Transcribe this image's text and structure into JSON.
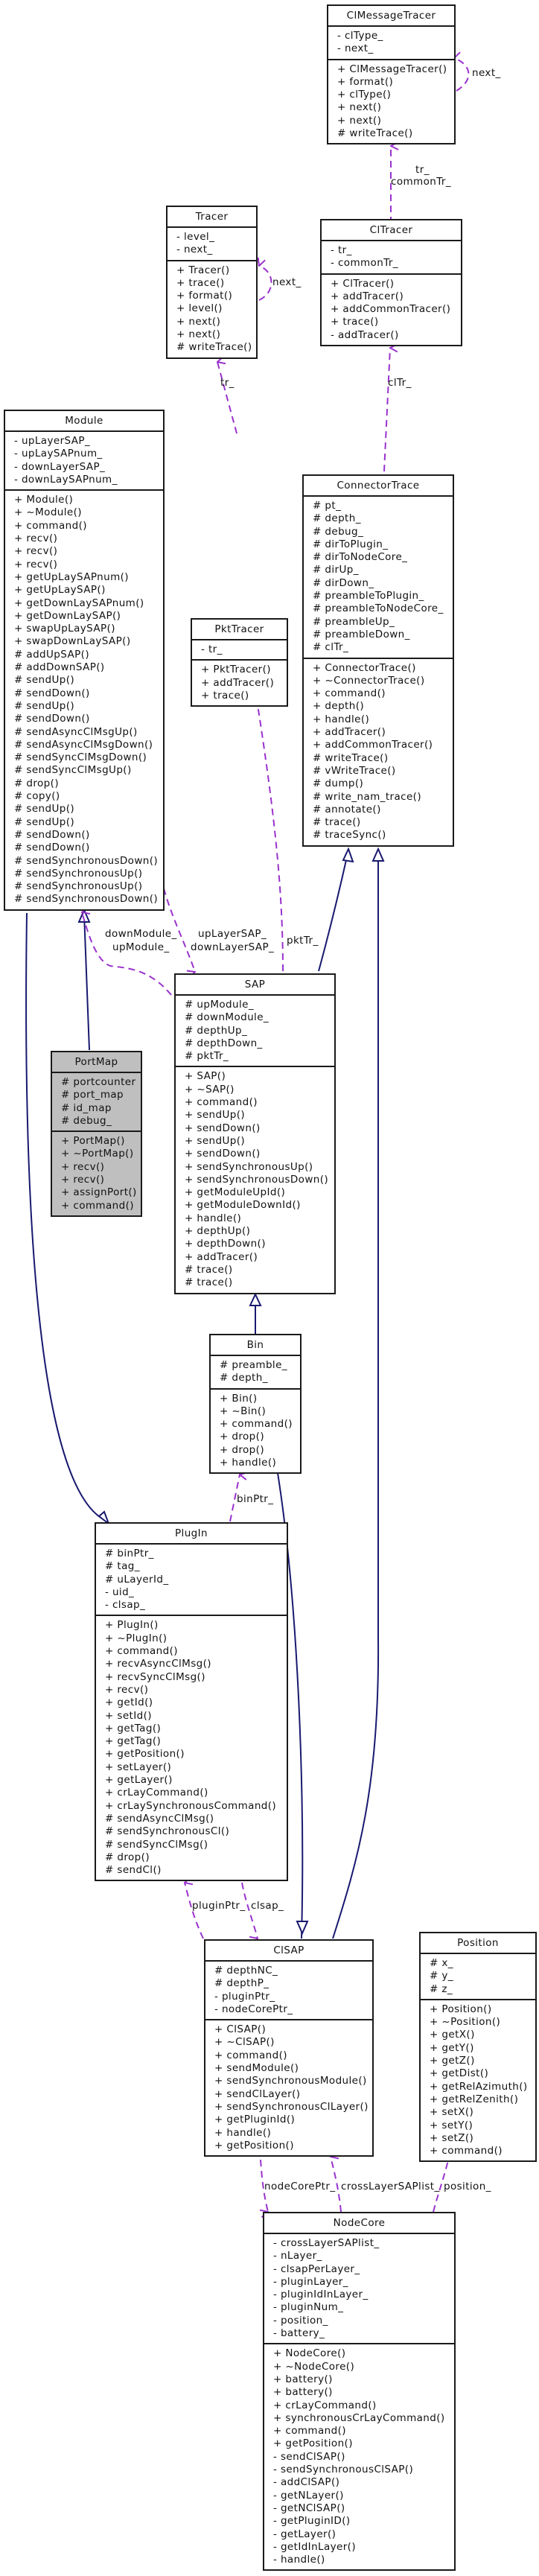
{
  "classes": {
    "clmessagetracer": {
      "name": "ClMessageTracer",
      "attributes": [
        "- clType_",
        "- next_"
      ],
      "methods": [
        "+ ClMessageTracer()",
        "+ format()",
        "+ clType()",
        "+ next()",
        "+ next()",
        "# writeTrace()"
      ]
    },
    "tracer": {
      "name": "Tracer",
      "attributes": [
        "- level_",
        "- next_"
      ],
      "methods": [
        "+ Tracer()",
        "+ trace()",
        "+ format()",
        "+ level()",
        "+ next()",
        "+ next()",
        "# writeTrace()"
      ]
    },
    "cltracer": {
      "name": "ClTracer",
      "attributes": [
        "- tr_",
        "- commonTr_"
      ],
      "methods": [
        "+ ClTracer()",
        "+ addTracer()",
        "+ addCommonTracer()",
        "+ trace()",
        "- addTracer()"
      ]
    },
    "module": {
      "name": "Module",
      "attributes": [
        "- upLayerSAP_",
        "- upLaySAPnum_",
        "- downLayerSAP_",
        "- downLaySAPnum_"
      ],
      "methods": [
        "+ Module()",
        "+ ~Module()",
        "+ command()",
        "+ recv()",
        "+ recv()",
        "+ recv()",
        "+ getUpLaySAPnum()",
        "+ getUpLaySAP()",
        "+ getDownLaySAPnum()",
        "+ getDownLaySAP()",
        "+ swapUpLaySAP()",
        "+ swapDownLaySAP()",
        "# addUpSAP()",
        "# addDownSAP()",
        "# sendUp()",
        "# sendDown()",
        "# sendUp()",
        "# sendDown()",
        "# sendAsyncClMsgUp()",
        "# sendAsyncClMsgDown()",
        "# sendSyncClMsgDown()",
        "# sendSyncClMsgUp()",
        "# drop()",
        "# copy()",
        "# sendUp()",
        "# sendUp()",
        "# sendDown()",
        "# sendDown()",
        "# sendSynchronousDown()",
        "# sendSynchronousUp()",
        "# sendSynchronousUp()",
        "# sendSynchronousDown()"
      ]
    },
    "pkttracer": {
      "name": "PktTracer",
      "attributes": [
        "- tr_"
      ],
      "methods": [
        "+ PktTracer()",
        "+ addTracer()",
        "+ trace()"
      ]
    },
    "connectortrace": {
      "name": "ConnectorTrace",
      "attributes": [
        "# pt_",
        "# depth_",
        "# debug_",
        "# dirToPlugin_",
        "# dirToNodeCore_",
        "# dirUp_",
        "# dirDown_",
        "# preambleToPlugin_",
        "# preambleToNodeCore_",
        "# preambleUp_",
        "# preambleDown_",
        "# clTr_"
      ],
      "methods": [
        "+ ConnectorTrace()",
        "+ ~ConnectorTrace()",
        "+ command()",
        "+ depth()",
        "+ handle()",
        "+ addTracer()",
        "+ addCommonTracer()",
        "# writeTrace()",
        "# vWriteTrace()",
        "# dump()",
        "# write_nam_trace()",
        "# annotate()",
        "# trace()",
        "# traceSync()"
      ]
    },
    "portmap": {
      "name": "PortMap",
      "attributes": [
        "# portcounter",
        "# port_map",
        "# id_map",
        "# debug_"
      ],
      "methods": [
        "+ PortMap()",
        "+ ~PortMap()",
        "+ recv()",
        "+ recv()",
        "+ assignPort()",
        "+ command()"
      ]
    },
    "sap": {
      "name": "SAP",
      "attributes": [
        "# upModule_",
        "# downModule_",
        "# depthUp_",
        "# depthDown_",
        "# pktTr_"
      ],
      "methods": [
        "+ SAP()",
        "+ ~SAP()",
        "+ command()",
        "+ sendUp()",
        "+ sendDown()",
        "+ sendUp()",
        "+ sendDown()",
        "+ sendSynchronousUp()",
        "+ sendSynchronousDown()",
        "+ getModuleUpId()",
        "+ getModuleDownId()",
        "+ handle()",
        "+ depthUp()",
        "+ depthDown()",
        "+ addTracer()",
        "# trace()",
        "# trace()"
      ]
    },
    "bin": {
      "name": "Bin",
      "attributes": [
        "# preamble_",
        "# depth_"
      ],
      "methods": [
        "+ Bin()",
        "+ ~Bin()",
        "+ command()",
        "+ drop()",
        "+ drop()",
        "+ handle()"
      ]
    },
    "plugin": {
      "name": "PlugIn",
      "attributes": [
        "# binPtr_",
        "# tag_",
        "# uLayerId_",
        "- uid_",
        "- clsap_"
      ],
      "methods": [
        "+ PlugIn()",
        "+ ~PlugIn()",
        "+ command()",
        "+ recvAsyncClMsg()",
        "+ recvSyncClMsg()",
        "+ recv()",
        "+ getId()",
        "+ setId()",
        "+ getTag()",
        "+ getTag()",
        "+ getPosition()",
        "+ setLayer()",
        "+ getLayer()",
        "+ crLayCommand()",
        "+ crLaySynchronousCommand()",
        "# sendAsyncClMsg()",
        "# sendSynchronousCl()",
        "# sendSyncClMsg()",
        "# drop()",
        "# sendCl()"
      ]
    },
    "clsap": {
      "name": "ClSAP",
      "attributes": [
        "# depthNC_",
        "# depthP_",
        "- pluginPtr_",
        "- nodeCorePtr_"
      ],
      "methods": [
        "+ ClSAP()",
        "+ ~ClSAP()",
        "+ command()",
        "+ sendModule()",
        "+ sendSynchronousModule()",
        "+ sendClLayer()",
        "+ sendSynchronousClLayer()",
        "+ getPluginId()",
        "+ handle()",
        "+ getPosition()"
      ]
    },
    "position": {
      "name": "Position",
      "attributes": [
        "# x_",
        "# y_",
        "# z_"
      ],
      "methods": [
        "+ Position()",
        "+ ~Position()",
        "+ getX()",
        "+ getY()",
        "+ getZ()",
        "+ getDist()",
        "+ getRelAzimuth()",
        "+ getRelZenith()",
        "+ setX()",
        "+ setY()",
        "+ setZ()",
        "+ command()"
      ]
    },
    "nodecore": {
      "name": "NodeCore",
      "attributes": [
        "- crossLayerSAPlist_",
        "- nLayer_",
        "- clsapPerLayer_",
        "- pluginLayer_",
        "- pluginIdInLayer_",
        "- pluginNum_",
        "- position_",
        "- battery_"
      ],
      "methods": [
        "+ NodeCore()",
        "+ ~NodeCore()",
        "+ battery()",
        "+ battery()",
        "+ crLayCommand()",
        "+ synchronousCrLayCommand()",
        "+ command()",
        "+ getPosition()",
        "- sendClSAP()",
        "- sendSynchronousClSAP()",
        "- addClSAP()",
        "- getNLayer()",
        "- getNClSAP()",
        "- getPluginID()",
        "- getLayer()",
        "- getIdInLayer()",
        "- handle()"
      ]
    }
  },
  "edge_labels": {
    "clmt_next": "next_",
    "tracer_next": "next_",
    "cltracer_to_clmt_1": "tr_",
    "cltracer_to_clmt_2": "commonTr_",
    "pkttracer_tr": "tr_",
    "connector_cltr": "clTr_",
    "sap_module_1": "downModule_",
    "sap_module_2": "upModule_",
    "module_sap_1": "upLayerSAP_",
    "module_sap_2": "downLayerSAP_",
    "sap_pkttr": "pktTr_",
    "clsap_binptr": "binPtr_",
    "clsap_pluginptr": "pluginPtr_",
    "plugin_clsap": "clsap_",
    "clsap_nodecoreptr": "nodeCorePtr_",
    "nodecore_crosslayer": "crossLayerSAPlist_",
    "nodecore_position": "position_"
  },
  "colors": {
    "inheritance": "#191970",
    "usage": "#9a32cd",
    "highlight_class_bg": "#bfbfbf"
  }
}
